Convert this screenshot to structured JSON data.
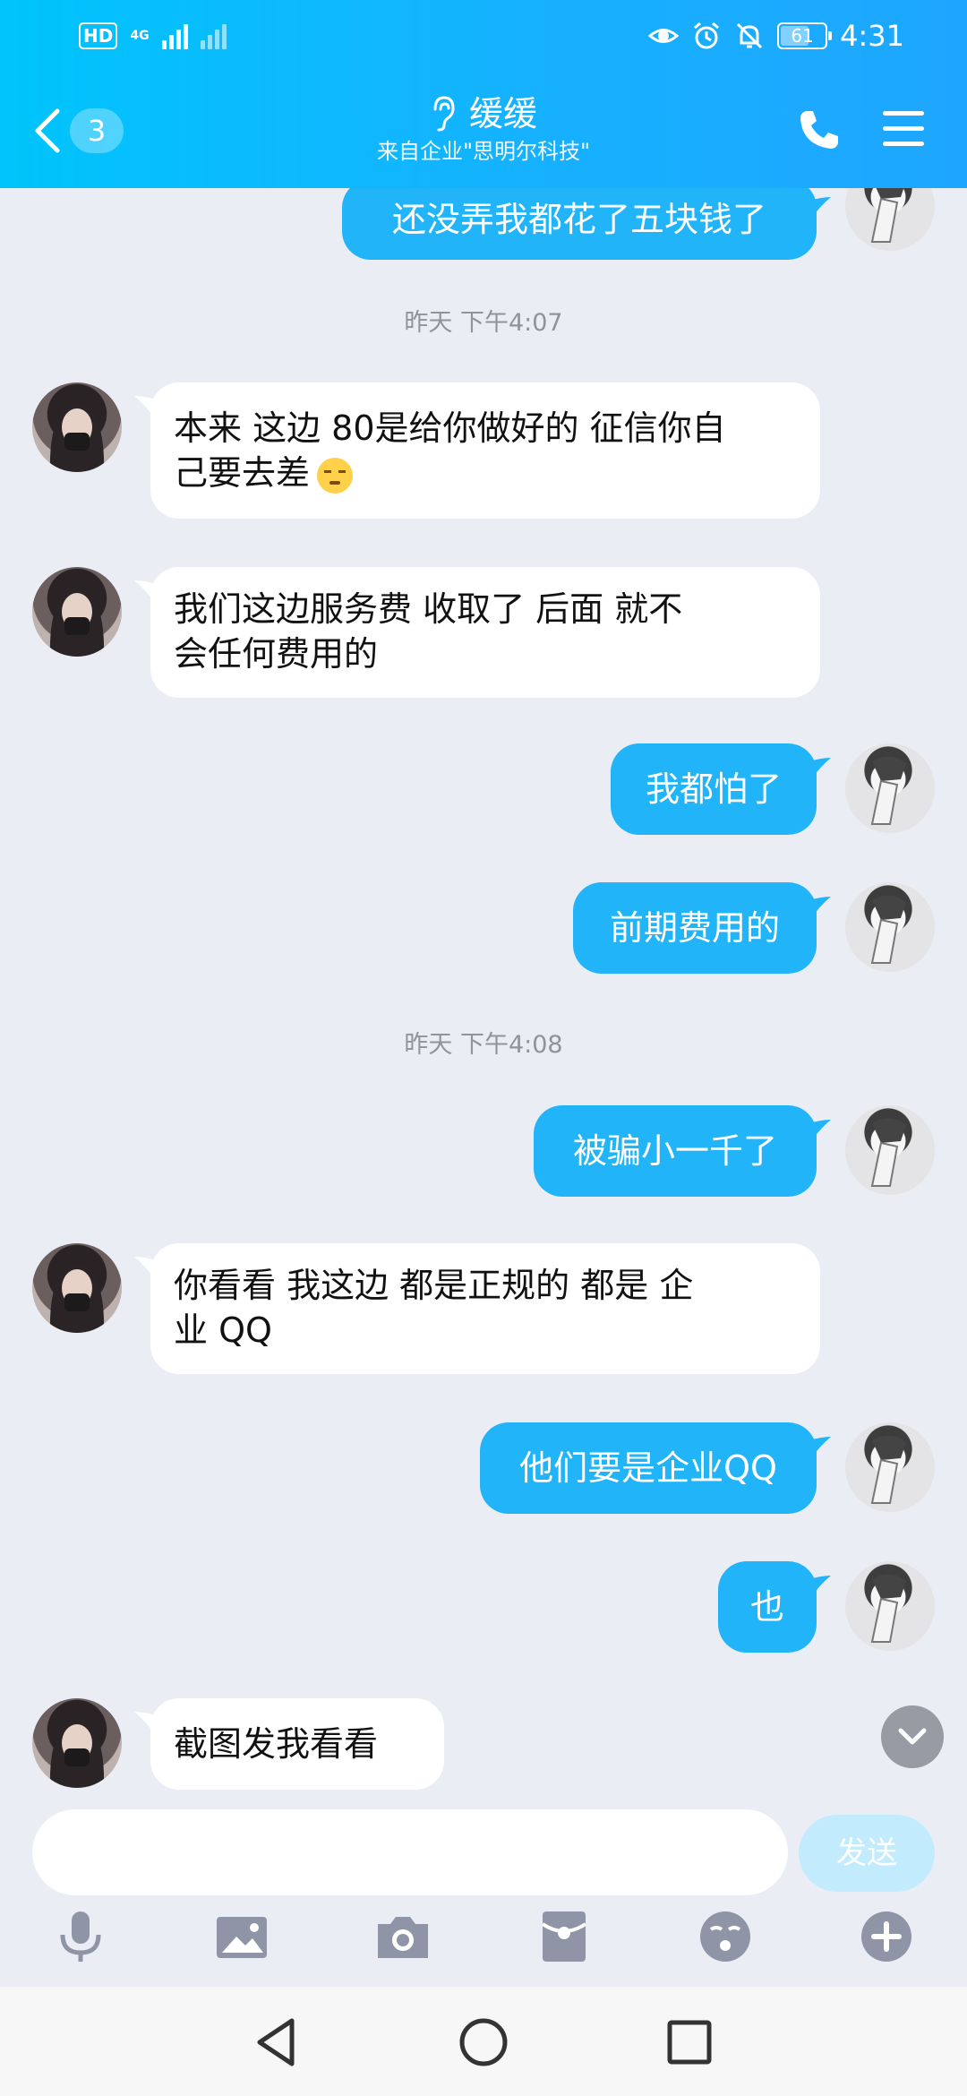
{
  "status_bar": {
    "hd": "HD",
    "network": "4G",
    "battery": "61",
    "time": "4:31"
  },
  "header": {
    "unread_count": "3",
    "contact_name": "缓缓",
    "subtitle": "来自企业\"思明尔科技\""
  },
  "messages": [
    {
      "id": "m0",
      "side": "out",
      "text": "还没弄我都花了五块钱了"
    },
    {
      "id": "t1",
      "type": "timestamp",
      "text": "昨天 下午4:07"
    },
    {
      "id": "m1",
      "side": "in",
      "line1": "本来 这边 80是给你做好的 征信你自",
      "line2": "己要去差"
    },
    {
      "id": "m2",
      "side": "in",
      "line1": "我们这边服务费  收取了  后面 就不",
      "line2": "会任何费用的"
    },
    {
      "id": "m3",
      "side": "out",
      "text": "我都怕了"
    },
    {
      "id": "m4",
      "side": "out",
      "text": "前期费用的"
    },
    {
      "id": "t2",
      "type": "timestamp",
      "text": "昨天 下午4:08"
    },
    {
      "id": "m5",
      "side": "out",
      "text": "被骗小一千了"
    },
    {
      "id": "m6",
      "side": "in",
      "line1": "你看看  我这边 都是正规的 都是 企",
      "line2": "业 QQ"
    },
    {
      "id": "m7",
      "side": "out",
      "text": "他们要是企业QQ"
    },
    {
      "id": "m8",
      "side": "out",
      "text": "也"
    },
    {
      "id": "m9",
      "side": "in",
      "text": "截图发我看看"
    }
  ],
  "input": {
    "placeholder": "",
    "send_label": "发送"
  },
  "toolbar": [
    "mic-icon",
    "image-icon",
    "camera-icon",
    "red-packet-icon",
    "emoji-icon",
    "plus-icon"
  ],
  "colors": {
    "header_start": "#00c4fb",
    "header_end": "#1ea6ff",
    "bubble_out": "#22b4f9",
    "bubble_in": "#ffffff",
    "chat_bg": "#ebedf5",
    "send_disabled": "#c2ecfd"
  }
}
